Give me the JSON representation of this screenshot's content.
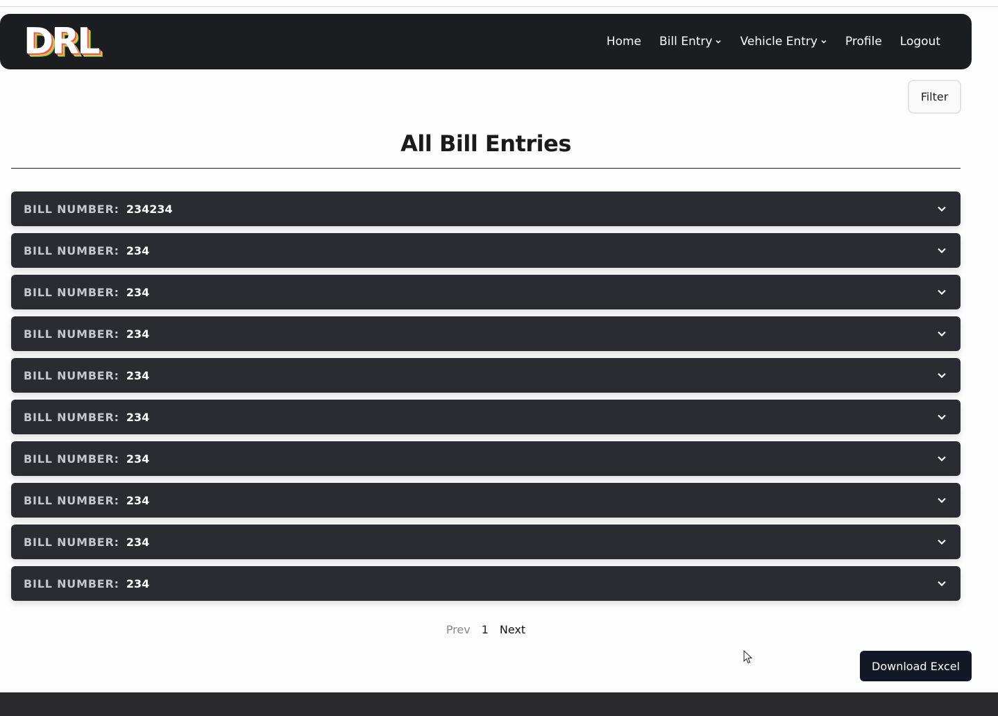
{
  "brand": {
    "logo_text": "DRL"
  },
  "nav": {
    "items": [
      {
        "label": "Home",
        "has_dropdown": false
      },
      {
        "label": "Bill Entry",
        "has_dropdown": true
      },
      {
        "label": "Vehicle Entry",
        "has_dropdown": true
      },
      {
        "label": "Profile",
        "has_dropdown": false
      },
      {
        "label": "Logout",
        "has_dropdown": false
      }
    ]
  },
  "toolbar": {
    "filter_label": "Filter"
  },
  "main": {
    "title": "All Bill Entries",
    "bill_label": "BILL NUMBER:",
    "bills": [
      {
        "number": "234234"
      },
      {
        "number": "234"
      },
      {
        "number": "234"
      },
      {
        "number": "234"
      },
      {
        "number": "234"
      },
      {
        "number": "234"
      },
      {
        "number": "234"
      },
      {
        "number": "234"
      },
      {
        "number": "234"
      },
      {
        "number": "234"
      }
    ]
  },
  "pagination": {
    "prev_label": "Prev",
    "current_page": "1",
    "next_label": "Next"
  },
  "actions": {
    "download_label": "Download Excel"
  },
  "colors": {
    "navbar_bg": "#1c1d20",
    "row_bg": "#2a2c31",
    "download_bg": "#121826",
    "footer_bg": "#2a2a2c"
  }
}
